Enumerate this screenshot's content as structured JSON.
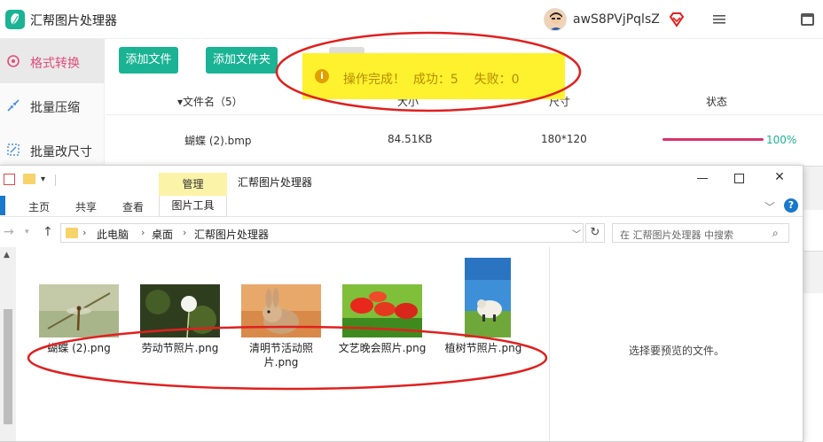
{
  "app": {
    "title": "汇帮图片处理器",
    "user_name": "awS8PVjPqlsZ",
    "icons": {
      "logo": "leaf-logo",
      "vip": "vip-diamond-icon",
      "menu": "hamburger-menu-icon",
      "maximize": "window-maximize-icon"
    },
    "sidebar": [
      {
        "label": "格式转换",
        "icon": "convert-icon",
        "active": true
      },
      {
        "label": "批量压缩",
        "icon": "compress-icon",
        "active": false
      },
      {
        "label": "批量改尺寸",
        "icon": "resize-icon",
        "active": false
      }
    ],
    "toolbar": {
      "add_file": "添加文件",
      "add_folder": "添加文件夹"
    },
    "table": {
      "columns": [
        "▾文件名（5）",
        "大小",
        "尺寸",
        "状态"
      ],
      "rows": [
        {
          "name": "蝴蝶 (2).bmp",
          "size": "84.51KB",
          "dims": "180*120",
          "progress": 1.0,
          "progress_text": "100%"
        }
      ]
    },
    "toast": {
      "icon": "info-icon",
      "text": "操作完成！  成功：5    失败：0"
    },
    "colors": {
      "accent": "#1ab394",
      "active_text": "#e24c7a",
      "toast_bg": "#fdf22d",
      "annotation": "#e0201f"
    }
  },
  "explorer": {
    "manage_tab": "管理",
    "title": "汇帮图片处理器",
    "ribbon_tabs": [
      "主页",
      "共享",
      "查看"
    ],
    "tool_tab": "图片工具",
    "breadcrumb": [
      "此电脑",
      "桌面",
      "汇帮图片处理器"
    ],
    "search_placeholder": "在 汇帮图片处理器 中搜索",
    "files": [
      {
        "name": "蝴蝶 (2).png",
        "thumb": "dragonfly"
      },
      {
        "name": "劳动节照片.png",
        "thumb": "dandelion"
      },
      {
        "name": "清明节活动照片.png",
        "thumb": "rabbit"
      },
      {
        "name": "文艺晚会照片.png",
        "thumb": "poppies"
      },
      {
        "name": "植树节照片.png",
        "thumb": "sheep"
      }
    ],
    "preview_text": "选择要预览的文件。"
  }
}
